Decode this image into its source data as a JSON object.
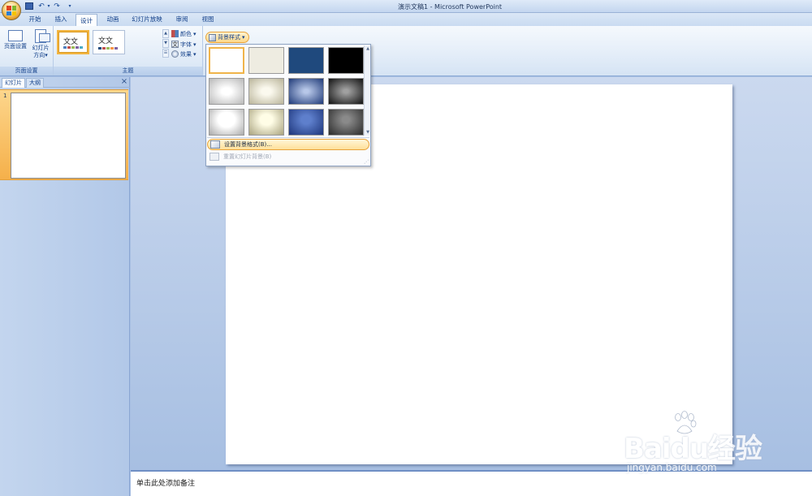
{
  "window": {
    "title": "演示文稿1 - Microsoft PowerPoint"
  },
  "quick_access": {
    "save_icon": "save-icon",
    "undo_icon": "undo-icon",
    "redo_icon": "redo-icon"
  },
  "ribbon_tabs": [
    {
      "label": "开始",
      "active": false
    },
    {
      "label": "插入",
      "active": false
    },
    {
      "label": "设计",
      "active": true
    },
    {
      "label": "动画",
      "active": false
    },
    {
      "label": "幻灯片放映",
      "active": false
    },
    {
      "label": "审阅",
      "active": false
    },
    {
      "label": "视图",
      "active": false
    }
  ],
  "ribbon": {
    "page_setup_group": {
      "label": "页面设置",
      "page_setup_btn": "页面设置",
      "orientation_btn_line1": "幻灯片",
      "orientation_btn_line2": "方向"
    },
    "themes_group": {
      "label": "主题",
      "theme1_text": "文文",
      "theme2_text": "文文",
      "colors_btn": "颜色",
      "fonts_btn": "字体",
      "effects_btn": "效果"
    },
    "background_styles_btn": "背景样式"
  },
  "background_dropdown": {
    "swatches": [
      {
        "style": "white",
        "selected": true
      },
      {
        "style": "light-gray",
        "selected": false
      },
      {
        "style": "dark-blue",
        "selected": false
      },
      {
        "style": "black",
        "selected": false
      },
      {
        "style": "white-radial",
        "selected": false
      },
      {
        "style": "beige-radial",
        "selected": false
      },
      {
        "style": "blue-radial",
        "selected": false
      },
      {
        "style": "black-radial",
        "selected": false
      },
      {
        "style": "white-glow",
        "selected": false
      },
      {
        "style": "cream-glow",
        "selected": false
      },
      {
        "style": "blue-glow",
        "selected": false
      },
      {
        "style": "gray-glow",
        "selected": false
      }
    ],
    "format_background": "设置背景格式(B)...",
    "reset_background": "重置幻灯片背景(B)"
  },
  "left_panel": {
    "tab_slides": "幻灯片",
    "tab_outline": "大纲",
    "close_icon": "close-icon",
    "slide_number": "1"
  },
  "notes": {
    "placeholder": "单击此处添加备注"
  },
  "watermark": {
    "brand": "Baidu经验",
    "url": "jingyan.baidu.com"
  },
  "colors": {
    "accent_orange": "#f0b44a",
    "ribbon_blue": "#15428b"
  }
}
